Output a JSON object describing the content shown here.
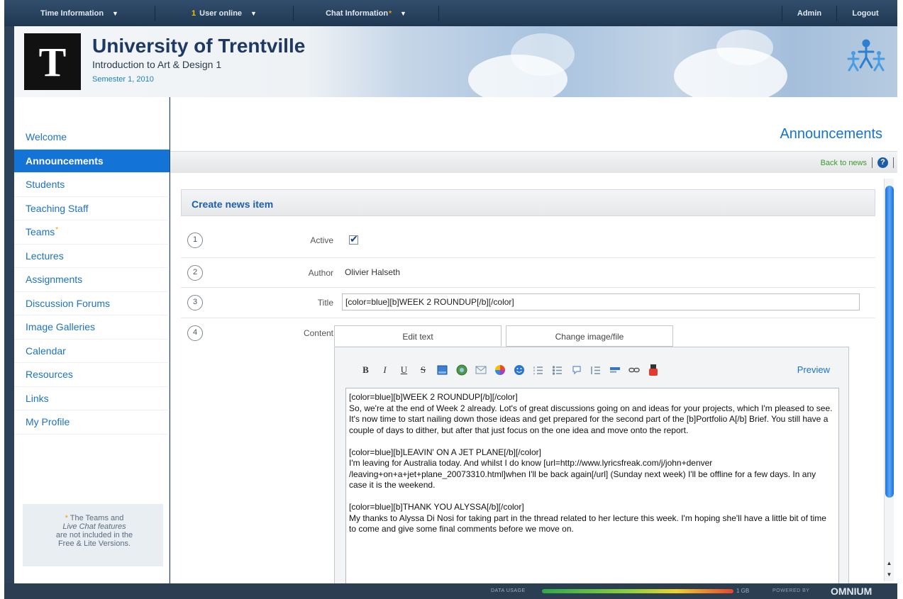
{
  "topbar": {
    "time_info": "Time Information",
    "users_count": "1",
    "users_label": "User online",
    "chat_info": "Chat Information",
    "chat_star": "*",
    "admin": "Admin",
    "logout": "Logout"
  },
  "header": {
    "logo_letter": "T",
    "university": "University of Trentville",
    "course": "Introduction to Art & Design 1",
    "semester": "Semester 1, 2010"
  },
  "sidebar": {
    "items": [
      {
        "label": "Welcome"
      },
      {
        "label": "Announcements",
        "active": true
      },
      {
        "label": "Students"
      },
      {
        "label": "Teaching Staff"
      },
      {
        "label": "Teams",
        "star": "*"
      },
      {
        "label": "Lectures"
      },
      {
        "label": "Assignments"
      },
      {
        "label": "Discussion Forums"
      },
      {
        "label": "Image Galleries"
      },
      {
        "label": "Calendar"
      },
      {
        "label": "Resources"
      },
      {
        "label": "Links"
      },
      {
        "label": "My Profile"
      }
    ],
    "note": {
      "star": "*",
      "line1": "The Teams and",
      "line2": "Live Chat features",
      "line3": "are not included in the",
      "line4": "Free & Lite Versions."
    }
  },
  "main": {
    "page_title": "Announcements",
    "back_link": "Back to news",
    "help_icon": "?",
    "form_title": "Create news item",
    "rows": [
      {
        "step": "1",
        "label": "Active",
        "checked": true
      },
      {
        "step": "2",
        "label": "Author",
        "value": "Olivier Halseth"
      },
      {
        "step": "3",
        "label": "Title",
        "value": "[color=blue][b]WEEK 2 ROUNDUP[/b][/color]"
      },
      {
        "step": "4",
        "label": "Content"
      }
    ],
    "tabs": [
      "Edit text",
      "Change image/file"
    ],
    "preview": "Preview",
    "toolbar_icons": [
      "bold",
      "italic",
      "underline",
      "strikethrough",
      "image-icon",
      "media-icon",
      "email-icon",
      "color-icon",
      "smiley-icon",
      "ordered-list-icon",
      "unordered-list-icon",
      "quote-icon",
      "indent-icon",
      "code-icon",
      "link-icon",
      "youtube-icon"
    ],
    "content": "[color=blue][b]WEEK 2 ROUNDUP[/b][/color]\nSo, we're at the end of Week 2 already. Lot's of great discussions going on and ideas for your projects, which I'm pleased to see. It's now time to start nailing down those ideas and get prepared for the second part of the [b]Portfolio A[/b] Brief. You still have a couple of days to dither, but after that just focus on the one idea and move onto the report.\n\n[color=blue][b]LEAVIN' ON A JET PLANE[/b][/color]\nI'm leaving for Australia today. And whilst I do know [url=http://www.lyricsfreak.com/j/john+denver\n/leaving+on+a+jet+plane_20073310.html]when I'll be back again[/url] (Sunday next week) I'll be offline for a few days. In any case it is the weekend.\n\n[color=blue][b]THANK YOU ALYSSA[/b][/color]\nMy thanks to Alyssa Di Nosi for taking part in the thread related to her lecture this week. I'm hoping she'll have a little bit of time to come and give some final comments before we move on."
  },
  "footer": {
    "data_usage_label": "DATA USAGE",
    "data_usage_max": "1 GB",
    "powered_by": "POWERED BY",
    "brand": "OMNIUM"
  },
  "colors": {
    "accent": "#1473d6",
    "topbar": "#2a4562",
    "link_green": "#3a9a2c",
    "star": "#f2a000"
  }
}
